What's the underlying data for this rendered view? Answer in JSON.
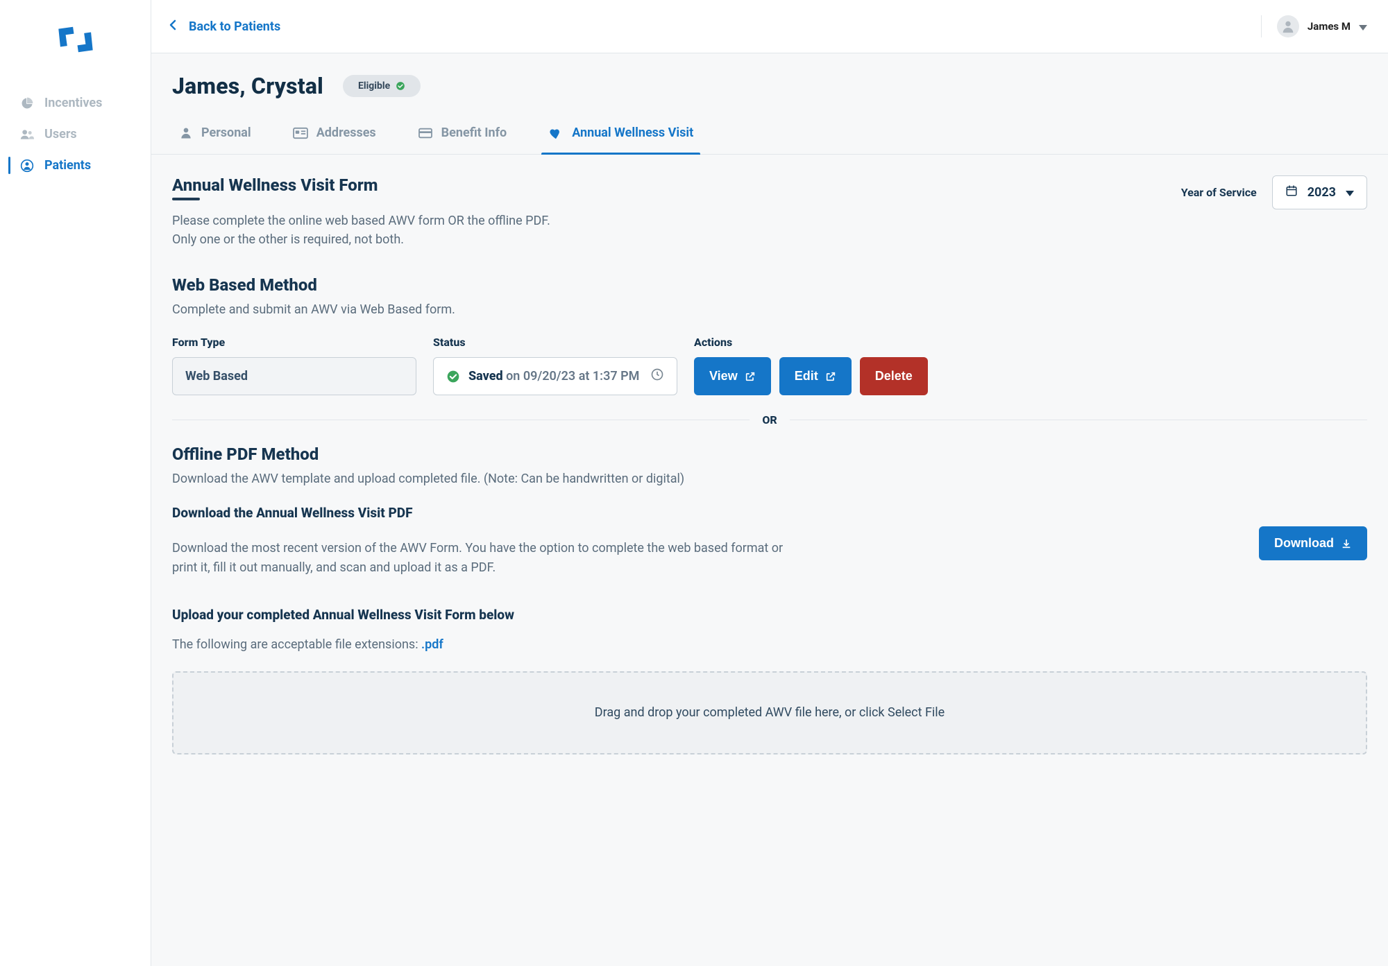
{
  "sidebar": {
    "items": [
      {
        "id": "incentives",
        "label": "Incentives"
      },
      {
        "id": "users",
        "label": "Users"
      },
      {
        "id": "patients",
        "label": "Patients"
      }
    ]
  },
  "topbar": {
    "back_label": "Back to Patients",
    "user_name": "James M"
  },
  "patient": {
    "name": "James, Crystal",
    "badge_label": "Eligible"
  },
  "tabs": [
    {
      "id": "personal",
      "label": "Personal"
    },
    {
      "id": "addresses",
      "label": "Addresses"
    },
    {
      "id": "benefit",
      "label": "Benefit Info"
    },
    {
      "id": "awv",
      "label": "Annual Wellness Visit"
    }
  ],
  "awv": {
    "title": "Annual Wellness Visit Form",
    "desc_line1": "Please complete the online web based AWV form OR the offline PDF.",
    "desc_line2": "Only one or the other is required, not both.",
    "yos_label": "Year of Service",
    "yos_value": "2023"
  },
  "web_method": {
    "title": "Web Based Method",
    "desc": "Complete and submit an AWV via Web Based form.",
    "col_form": "Form Type",
    "col_status": "Status",
    "col_actions": "Actions",
    "form_type_value": "Web Based",
    "status_primary": "Saved",
    "status_secondary": "on 09/20/23 at 1:37 PM",
    "view_label": "View",
    "edit_label": "Edit",
    "delete_label": "Delete"
  },
  "or_label": "OR",
  "pdf_method": {
    "title": "Offline PDF Method",
    "desc": "Download the AWV template and upload completed file. (Note: Can be handwritten or digital)",
    "download_heading": "Download the Annual Wellness Visit PDF",
    "download_desc": "Download the most recent version of the AWV Form. You have the option to complete the web based format or print it, fill it out manually, and scan and upload it as a PDF.",
    "download_label": "Download",
    "upload_heading": "Upload your completed Annual Wellness Visit Form below",
    "upload_desc_prefix": "The following are acceptable file extensions: ",
    "upload_ext": ".pdf",
    "dropzone_text": "Drag and drop your completed AWV file here, or click Select File"
  }
}
